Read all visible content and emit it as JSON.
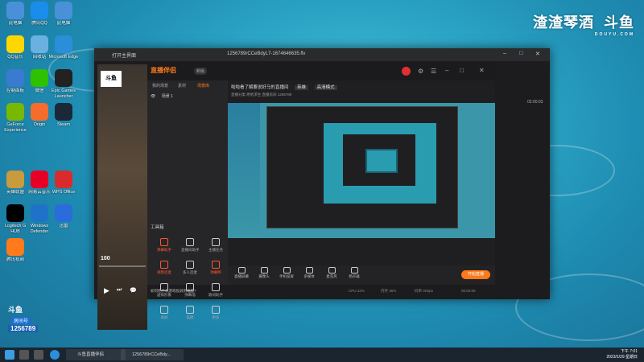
{
  "desktop": {
    "icons": [
      {
        "label": "此电脑",
        "color": "#4a90d9"
      },
      {
        "label": "腾讯QQ",
        "color": "#1a8ceb"
      },
      {
        "label": "此电脑",
        "color": "#4a90d9"
      },
      {
        "label": "QQ音乐",
        "color": "#ffd700"
      },
      {
        "label": "回收站",
        "color": "#6ab0e0"
      },
      {
        "label": "Microsoft Edge",
        "color": "#2a8fd8"
      },
      {
        "label": "控制面板",
        "color": "#3a7ad0"
      },
      {
        "label": "微信",
        "color": "#2dc100"
      },
      {
        "label": "Epic Games Launcher",
        "color": "#222"
      },
      {
        "label": "GeForce Experience",
        "color": "#76b900"
      },
      {
        "label": "Origin",
        "color": "#f56c2d"
      },
      {
        "label": "Steam",
        "color": "#1b2838"
      },
      {
        "label": "英雄联盟",
        "color": "#c89b3c"
      },
      {
        "label": "网易云音乐",
        "color": "#e60026"
      },
      {
        "label": "WPS Office",
        "color": "#d92b2b"
      },
      {
        "label": "Logitech G HUB",
        "color": "#000"
      },
      {
        "label": "Windows Defender",
        "color": "#1e73c9"
      },
      {
        "label": "迅雷",
        "color": "#2a6cdb"
      },
      {
        "label": "腾讯视频",
        "color": "#ff7a1a"
      }
    ]
  },
  "watermark": {
    "main": "渣渣琴酒",
    "brand": "斗鱼",
    "domain": "DOUYU.COM"
  },
  "window": {
    "title_left": "打开主界面",
    "title_center": "1256789rCCeBdyL7-1674646635.flv",
    "controls": [
      "–",
      "□",
      "✕"
    ]
  },
  "app": {
    "logo": "直播伴侣",
    "version": "新版",
    "tabs": [
      "我的场景",
      "素材",
      "场景库"
    ],
    "scene_item": "场景 1",
    "stream_title": "啦啦看了解要说好马的直播间",
    "stream_tag": "英雄",
    "quality": "高清模式",
    "sub_info": "直播分类  绝地求生  直播房间  1256789",
    "tools_title": "工具箱",
    "tools": [
      {
        "label": "弹幕助手",
        "active": true
      },
      {
        "label": "直播间助手",
        "active": false
      },
      {
        "label": "主播任务",
        "active": false
      },
      {
        "label": "视频连麦",
        "active": true
      },
      {
        "label": "多人连麦",
        "active": false
      },
      {
        "label": "弹幕鸭",
        "active": true
      },
      {
        "label": "虚拟形象",
        "active": false
      },
      {
        "label": "弹幕墙",
        "active": false
      },
      {
        "label": "歌词助手",
        "active": false
      },
      {
        "label": "录屏",
        "active": false
      },
      {
        "label": "美颜",
        "active": false
      },
      {
        "label": "更多",
        "active": false
      }
    ],
    "bottom_buttons": [
      "直播屏幕",
      "摄像头",
      "手机投屏",
      "多媒体",
      "麦克风",
      "扬声器"
    ],
    "start_button": "开始直播",
    "status_hint": "如何把手机游戏投屏到电脑?",
    "status_items": [
      "CPU 22%",
      "内存 35%",
      "码率 0Kbps",
      "00:00:00"
    ],
    "right_time": "02:00:03"
  },
  "player": {
    "time": "100"
  },
  "live_badge": {
    "title": "斗鱼",
    "label": "房间号",
    "room": "1256789"
  },
  "taskbar": {
    "tasks": [
      "斗鱼直播伴侣",
      "1256789rCCeBdy..."
    ],
    "time": "下午 7:01",
    "date": "2023/1/29 星期日"
  }
}
